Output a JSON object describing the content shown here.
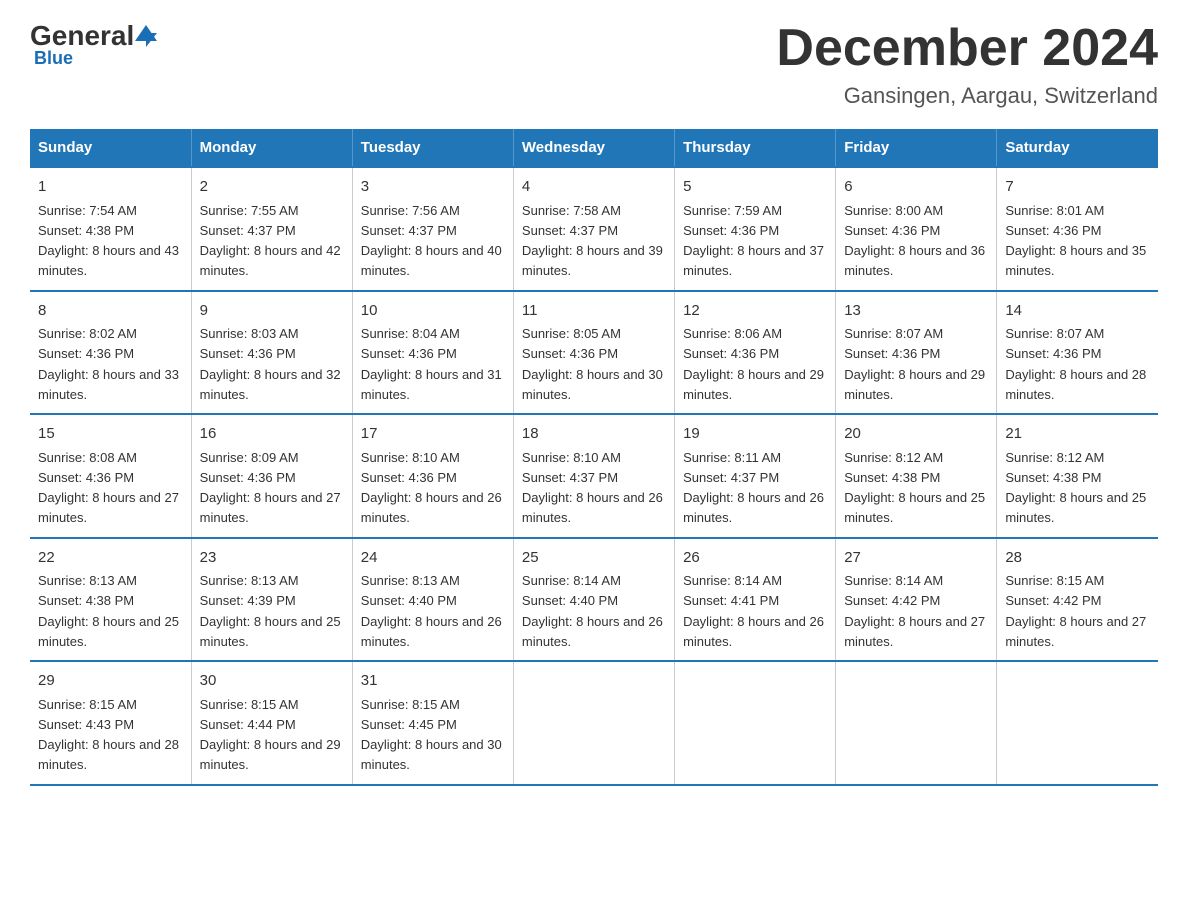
{
  "header": {
    "logo_general": "General",
    "logo_blue": "Blue",
    "title": "December 2024",
    "subtitle": "Gansingen, Aargau, Switzerland"
  },
  "columns": [
    "Sunday",
    "Monday",
    "Tuesday",
    "Wednesday",
    "Thursday",
    "Friday",
    "Saturday"
  ],
  "weeks": [
    [
      {
        "day": "1",
        "sunrise": "7:54 AM",
        "sunset": "4:38 PM",
        "daylight": "8 hours and 43 minutes."
      },
      {
        "day": "2",
        "sunrise": "7:55 AM",
        "sunset": "4:37 PM",
        "daylight": "8 hours and 42 minutes."
      },
      {
        "day": "3",
        "sunrise": "7:56 AM",
        "sunset": "4:37 PM",
        "daylight": "8 hours and 40 minutes."
      },
      {
        "day": "4",
        "sunrise": "7:58 AM",
        "sunset": "4:37 PM",
        "daylight": "8 hours and 39 minutes."
      },
      {
        "day": "5",
        "sunrise": "7:59 AM",
        "sunset": "4:36 PM",
        "daylight": "8 hours and 37 minutes."
      },
      {
        "day": "6",
        "sunrise": "8:00 AM",
        "sunset": "4:36 PM",
        "daylight": "8 hours and 36 minutes."
      },
      {
        "day": "7",
        "sunrise": "8:01 AM",
        "sunset": "4:36 PM",
        "daylight": "8 hours and 35 minutes."
      }
    ],
    [
      {
        "day": "8",
        "sunrise": "8:02 AM",
        "sunset": "4:36 PM",
        "daylight": "8 hours and 33 minutes."
      },
      {
        "day": "9",
        "sunrise": "8:03 AM",
        "sunset": "4:36 PM",
        "daylight": "8 hours and 32 minutes."
      },
      {
        "day": "10",
        "sunrise": "8:04 AM",
        "sunset": "4:36 PM",
        "daylight": "8 hours and 31 minutes."
      },
      {
        "day": "11",
        "sunrise": "8:05 AM",
        "sunset": "4:36 PM",
        "daylight": "8 hours and 30 minutes."
      },
      {
        "day": "12",
        "sunrise": "8:06 AM",
        "sunset": "4:36 PM",
        "daylight": "8 hours and 29 minutes."
      },
      {
        "day": "13",
        "sunrise": "8:07 AM",
        "sunset": "4:36 PM",
        "daylight": "8 hours and 29 minutes."
      },
      {
        "day": "14",
        "sunrise": "8:07 AM",
        "sunset": "4:36 PM",
        "daylight": "8 hours and 28 minutes."
      }
    ],
    [
      {
        "day": "15",
        "sunrise": "8:08 AM",
        "sunset": "4:36 PM",
        "daylight": "8 hours and 27 minutes."
      },
      {
        "day": "16",
        "sunrise": "8:09 AM",
        "sunset": "4:36 PM",
        "daylight": "8 hours and 27 minutes."
      },
      {
        "day": "17",
        "sunrise": "8:10 AM",
        "sunset": "4:36 PM",
        "daylight": "8 hours and 26 minutes."
      },
      {
        "day": "18",
        "sunrise": "8:10 AM",
        "sunset": "4:37 PM",
        "daylight": "8 hours and 26 minutes."
      },
      {
        "day": "19",
        "sunrise": "8:11 AM",
        "sunset": "4:37 PM",
        "daylight": "8 hours and 26 minutes."
      },
      {
        "day": "20",
        "sunrise": "8:12 AM",
        "sunset": "4:38 PM",
        "daylight": "8 hours and 25 minutes."
      },
      {
        "day": "21",
        "sunrise": "8:12 AM",
        "sunset": "4:38 PM",
        "daylight": "8 hours and 25 minutes."
      }
    ],
    [
      {
        "day": "22",
        "sunrise": "8:13 AM",
        "sunset": "4:38 PM",
        "daylight": "8 hours and 25 minutes."
      },
      {
        "day": "23",
        "sunrise": "8:13 AM",
        "sunset": "4:39 PM",
        "daylight": "8 hours and 25 minutes."
      },
      {
        "day": "24",
        "sunrise": "8:13 AM",
        "sunset": "4:40 PM",
        "daylight": "8 hours and 26 minutes."
      },
      {
        "day": "25",
        "sunrise": "8:14 AM",
        "sunset": "4:40 PM",
        "daylight": "8 hours and 26 minutes."
      },
      {
        "day": "26",
        "sunrise": "8:14 AM",
        "sunset": "4:41 PM",
        "daylight": "8 hours and 26 minutes."
      },
      {
        "day": "27",
        "sunrise": "8:14 AM",
        "sunset": "4:42 PM",
        "daylight": "8 hours and 27 minutes."
      },
      {
        "day": "28",
        "sunrise": "8:15 AM",
        "sunset": "4:42 PM",
        "daylight": "8 hours and 27 minutes."
      }
    ],
    [
      {
        "day": "29",
        "sunrise": "8:15 AM",
        "sunset": "4:43 PM",
        "daylight": "8 hours and 28 minutes."
      },
      {
        "day": "30",
        "sunrise": "8:15 AM",
        "sunset": "4:44 PM",
        "daylight": "8 hours and 29 minutes."
      },
      {
        "day": "31",
        "sunrise": "8:15 AM",
        "sunset": "4:45 PM",
        "daylight": "8 hours and 30 minutes."
      },
      null,
      null,
      null,
      null
    ]
  ]
}
